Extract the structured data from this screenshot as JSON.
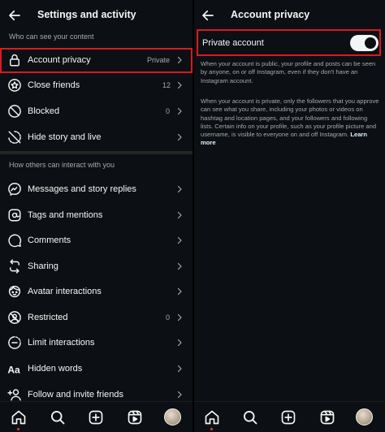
{
  "left": {
    "title": "Settings and activity",
    "section1_header": "Who can see your content",
    "section1_items": [
      {
        "label": "Account privacy",
        "value": "Private",
        "icon": "lock-icon"
      },
      {
        "label": "Close friends",
        "value": "12",
        "icon": "star-circle-icon"
      },
      {
        "label": "Blocked",
        "value": "0",
        "icon": "blocked-icon"
      },
      {
        "label": "Hide story and live",
        "value": "",
        "icon": "hide-story-icon"
      }
    ],
    "section2_header": "How others can interact with you",
    "section2_items": [
      {
        "label": "Messages and story replies",
        "value": "",
        "icon": "messenger-icon"
      },
      {
        "label": "Tags and mentions",
        "value": "",
        "icon": "at-sign-icon"
      },
      {
        "label": "Comments",
        "value": "",
        "icon": "comment-icon"
      },
      {
        "label": "Sharing",
        "value": "",
        "icon": "repost-icon"
      },
      {
        "label": "Avatar interactions",
        "value": "",
        "icon": "avatar-icon"
      },
      {
        "label": "Restricted",
        "value": "0",
        "icon": "restricted-icon"
      },
      {
        "label": "Limit interactions",
        "value": "",
        "icon": "limit-interactions-icon"
      },
      {
        "label": "Hidden words",
        "value": "",
        "icon": "hidden-words-icon"
      },
      {
        "label": "Follow and invite friends",
        "value": "",
        "icon": "add-person-icon"
      }
    ]
  },
  "right": {
    "title": "Account privacy",
    "toggle_label": "Private account",
    "toggle_on": true,
    "desc_public": "When your account is public, your profile and posts can be seen by anyone, on or off Instagram, even if they don't have an Instagram account.",
    "desc_private": "When your account is private, only the followers that you approve can see what you share, including your photos or videos on hashtag and location pages, and your followers and following lists. Certain info on your profile, such as your profile picture and username, is visible to everyone on and off Instagram.",
    "learn_more": "Learn more"
  },
  "nav_icons": [
    "home-icon",
    "search-icon",
    "create-icon",
    "reels-icon",
    "profile-avatar"
  ],
  "colors": {
    "background": "#0c1014",
    "text_primary": "#f5f5f5",
    "text_secondary": "#a8a8a8",
    "highlight_border": "#d91a20",
    "divider": "#262626",
    "notification_dot": "#ff3040"
  }
}
